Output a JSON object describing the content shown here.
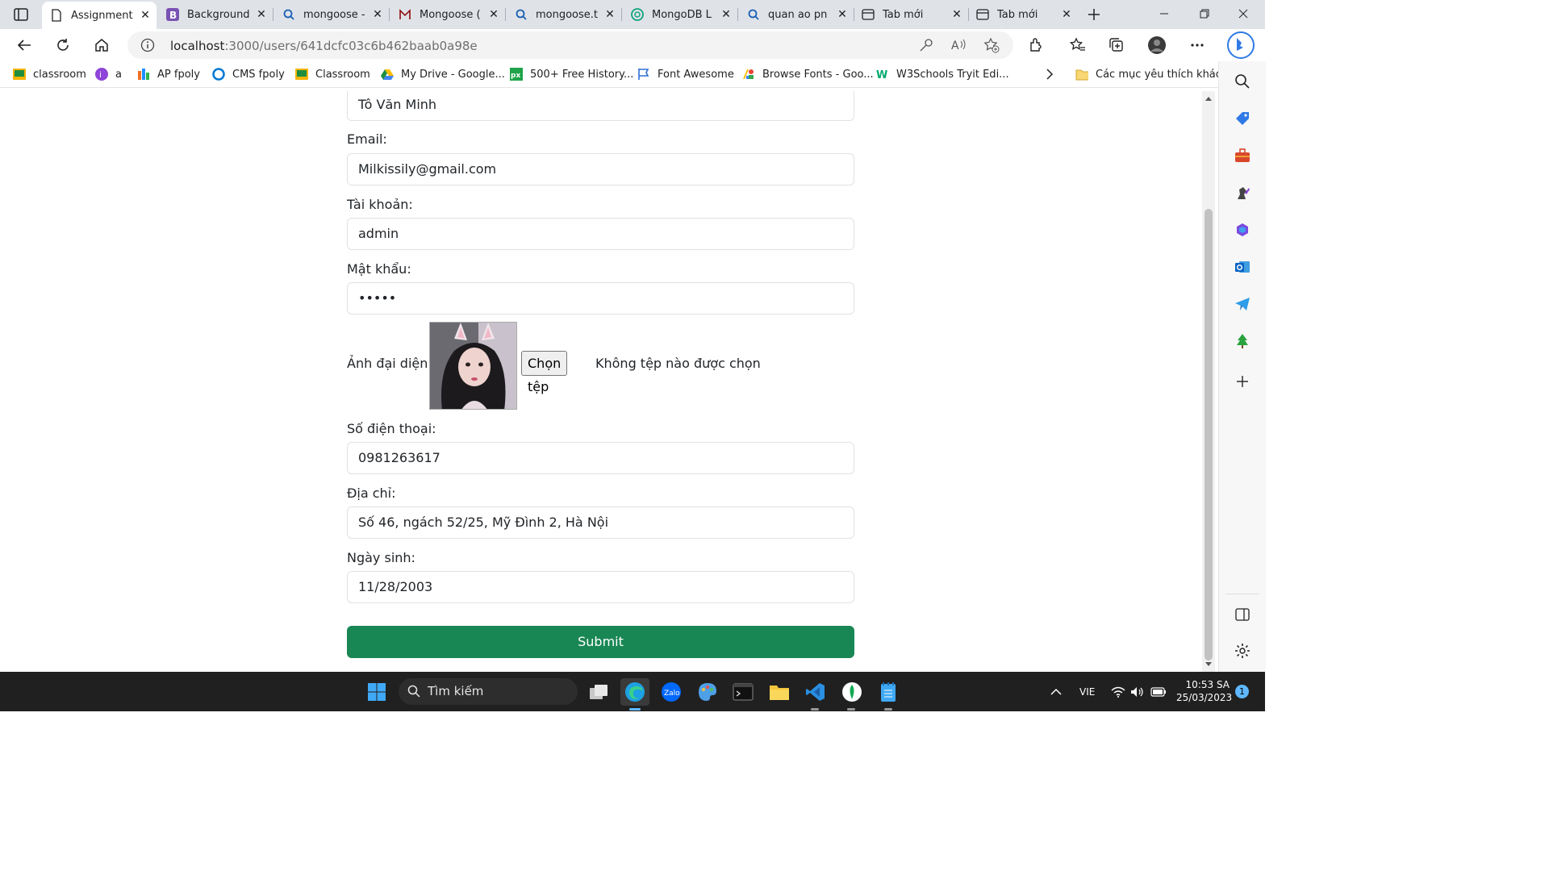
{
  "browser": {
    "tabs": [
      {
        "title": "Assignment",
        "favicon": "page-icon",
        "active": true
      },
      {
        "title": "Background",
        "favicon": "bootstrap-icon"
      },
      {
        "title": "mongoose -",
        "favicon": "search-icon"
      },
      {
        "title": "Mongoose (",
        "favicon": "mongoose-icon"
      },
      {
        "title": "mongoose.t",
        "favicon": "search-icon"
      },
      {
        "title": "MongoDB L",
        "favicon": "chatgpt-icon"
      },
      {
        "title": "quan ao pn",
        "favicon": "search-icon"
      },
      {
        "title": "Tab mới",
        "favicon": "newtab-icon"
      },
      {
        "title": "Tab mới",
        "favicon": "newtab-icon"
      }
    ],
    "url_host": "localhost",
    "url_path": ":3000/users/641dcfc03c6b462baab0a98e",
    "bookmarks": [
      {
        "label": "classroom",
        "icon": "classroom-icon"
      },
      {
        "label": "a",
        "icon": "a-icon"
      },
      {
        "label": "AP fpoly",
        "icon": "fpoly-icon"
      },
      {
        "label": "CMS fpoly",
        "icon": "cms-icon"
      },
      {
        "label": "Classroom",
        "icon": "classroom-icon"
      },
      {
        "label": "My Drive - Google...",
        "icon": "drive-icon"
      },
      {
        "label": "500+ Free History...",
        "icon": "px-icon"
      },
      {
        "label": "Font Awesome",
        "icon": "flag-icon"
      },
      {
        "label": "Browse Fonts - Goo...",
        "icon": "google-fonts-icon"
      },
      {
        "label": "W3Schools Tryit Edi...",
        "icon": "w3schools-icon"
      }
    ],
    "other_bookmarks": "Các mục yêu thích khác"
  },
  "form": {
    "name_value": "Tô Văn Minh",
    "email_label": "Email:",
    "email_value": "Milkissily@gmail.com",
    "account_label": "Tài khoản:",
    "account_value": "admin",
    "password_label": "Mật khẩu:",
    "password_value": "•••••",
    "avatar_label": "Ảnh đại diện",
    "file_button": "Chọn tệp",
    "file_status": "Không tệp nào được chọn",
    "phone_label": "Số điện thoại:",
    "phone_value": "0981263617",
    "address_label": "Địa chỉ:",
    "address_value": "Số 46, ngách 52/25, Mỹ Đình 2, Hà Nội",
    "dob_label": "Ngày sinh:",
    "dob_value": "11/28/2003",
    "submit": "Submit"
  },
  "taskbar": {
    "search_placeholder": "Tìm kiếm",
    "language": "VIE",
    "time": "10:53 SA",
    "date": "25/03/2023",
    "notification_count": "1"
  },
  "colors": {
    "submit_bg": "#198754",
    "tabstrip_bg": "#dfe3e8",
    "taskbar_bg": "#202020"
  }
}
